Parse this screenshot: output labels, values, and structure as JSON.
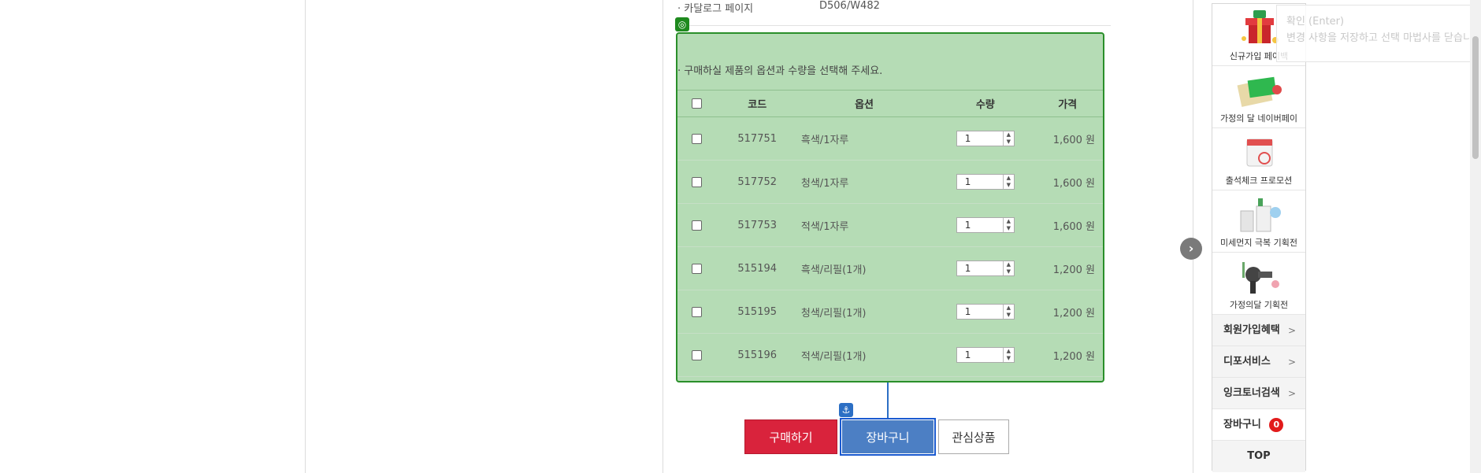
{
  "catalog": {
    "label": "·  카달로그 페이지",
    "value": "D506/W482"
  },
  "options": {
    "notice": "·  구매하실 제품의 옵션과 수량을 선택해 주세요.",
    "headers": {
      "code": "코드",
      "option": "옵션",
      "qty": "수량",
      "price": "가격"
    },
    "rows": [
      {
        "code": "517751",
        "option": "흑색/1자루",
        "qty": "1",
        "price": "1,600 원"
      },
      {
        "code": "517752",
        "option": "청색/1자루",
        "qty": "1",
        "price": "1,600 원"
      },
      {
        "code": "517753",
        "option": "적색/1자루",
        "qty": "1",
        "price": "1,600 원"
      },
      {
        "code": "515194",
        "option": "흑색/리필(1개)",
        "qty": "1",
        "price": "1,200 원"
      },
      {
        "code": "515195",
        "option": "청색/리필(1개)",
        "qty": "1",
        "price": "1,200 원"
      },
      {
        "code": "515196",
        "option": "적색/리필(1개)",
        "qty": "1",
        "price": "1,200 원"
      }
    ]
  },
  "actions": {
    "buy": "구매하기",
    "cart": "장바구니",
    "wishlist": "관심상품"
  },
  "sidebar": {
    "promos": [
      {
        "caption": "신규가입 페이백",
        "icon": "gift-box-icon"
      },
      {
        "caption": "가정의 달 네이버페이",
        "icon": "naverpay-envelope-icon"
      },
      {
        "caption": "출석체크 프로모션",
        "icon": "calendar-check-icon"
      },
      {
        "caption": "미세먼지 극복 기획전",
        "icon": "air-purifier-icon"
      },
      {
        "caption": "가정의달 기획전",
        "icon": "hair-dryer-icon"
      }
    ],
    "menu": {
      "member_benefit": "회원가입혜택",
      "depo_service": "디포서비스",
      "ink_toner": "잉크토너검색",
      "cart": "장바구니",
      "cart_count": "0",
      "top": "TOP"
    }
  },
  "tooltip": {
    "title": "확인 (Enter)",
    "message": "변경 사항을 저장하고 선택 마법사를 닫습니다"
  },
  "colors": {
    "highlight_fill": "#b5dcb5",
    "highlight_border": "#2a8f2a",
    "buy": "#d9233c",
    "cart": "#4c7fc4",
    "badge": "#e21b1b"
  }
}
